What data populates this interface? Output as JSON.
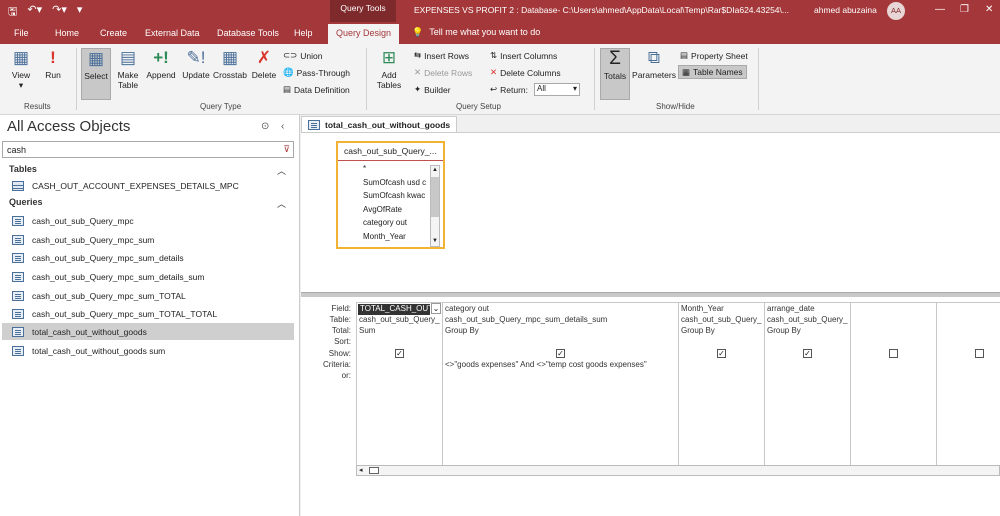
{
  "titlebar": {
    "context_tab": "Query Tools",
    "document_title": "EXPENSES VS PROFIT 2 : Database- C:\\Users\\ahmed\\AppData\\Local\\Temp\\Rar$DIa624.43254\\...",
    "user_name": "ahmed abuzaina",
    "avatar_initials": "AA",
    "accent_color": "#a4373a"
  },
  "tabs": [
    {
      "label": "File"
    },
    {
      "label": "Home"
    },
    {
      "label": "Create"
    },
    {
      "label": "External Data"
    },
    {
      "label": "Database Tools"
    },
    {
      "label": "Help"
    },
    {
      "label": "Query Design"
    }
  ],
  "tell_me": "Tell me what you want to do",
  "ribbon": {
    "results": {
      "label": "Results",
      "view": "View",
      "run": "Run"
    },
    "query_type": {
      "label": "Query Type",
      "select": "Select",
      "make_table": "Make Table",
      "append": "Append",
      "update": "Update",
      "crosstab": "Crosstab",
      "delete": "Delete",
      "union": "Union",
      "pass_through": "Pass-Through",
      "data_definition": "Data Definition"
    },
    "query_setup": {
      "label": "Query Setup",
      "add_tables": "Add Tables",
      "insert_rows": "Insert Rows",
      "delete_rows": "Delete Rows",
      "builder": "Builder",
      "insert_columns": "Insert Columns",
      "delete_columns": "Delete Columns",
      "return_label": "Return:",
      "return_value": "All"
    },
    "show_hide": {
      "label": "Show/Hide",
      "totals": "Totals",
      "parameters": "Parameters",
      "property_sheet": "Property Sheet",
      "table_names": "Table Names"
    }
  },
  "nav": {
    "title": "All Access Objects",
    "search_value": "cash",
    "tables_header": "Tables",
    "tables": [
      "CASH_OUT_ACCOUNT_EXPENSES_DETAILS_MPC"
    ],
    "queries_header": "Queries",
    "queries": [
      "cash_out_sub_Query_mpc",
      "cash_out_sub_Query_mpc_sum",
      "cash_out_sub_Query_mpc_sum_details",
      "cash_out_sub_Query_mpc_sum_details_sum",
      "cash_out_sub_Query_mpc_sum_TOTAL",
      "cash_out_sub_Query_mpc_sum_TOTAL_TOTAL",
      "total_cash_out_without_goods",
      "total_cash_out_without_goods sum"
    ],
    "selected_query": "total_cash_out_without_goods"
  },
  "document_tab": "total_cash_out_without_goods",
  "field_list": {
    "title": "cash_out_sub_Query_...",
    "fields": [
      "*",
      "SumOfcash usd c",
      "SumOfcash kwac",
      "AvgOfRate",
      "category out",
      "Month_Year"
    ]
  },
  "grid": {
    "row_labels": [
      "Field:",
      "Table:",
      "Total:",
      "Sort:",
      "Show:",
      "Criteria:",
      "or:"
    ],
    "columns": [
      {
        "field": "TOTAL_CASH_OUT",
        "table": "cash_out_sub_Query_",
        "total": "Sum",
        "show": true,
        "criteria": ""
      },
      {
        "field": "category out",
        "table": "cash_out_sub_Query_mpc_sum_details_sum",
        "total": "Group By",
        "show": true,
        "criteria": "<>\"goods expenses\" And <>\"temp cost goods expenses\""
      },
      {
        "field": "Month_Year",
        "table": "cash_out_sub_Query_",
        "total": "Group By",
        "show": true,
        "criteria": ""
      },
      {
        "field": "arrange_date",
        "table": "cash_out_sub_Query_",
        "total": "Group By",
        "show": true,
        "criteria": ""
      },
      {
        "field": "",
        "table": "",
        "total": "",
        "show": false,
        "criteria": ""
      },
      {
        "field": "",
        "table": "",
        "total": "",
        "show": false,
        "criteria": ""
      }
    ]
  }
}
